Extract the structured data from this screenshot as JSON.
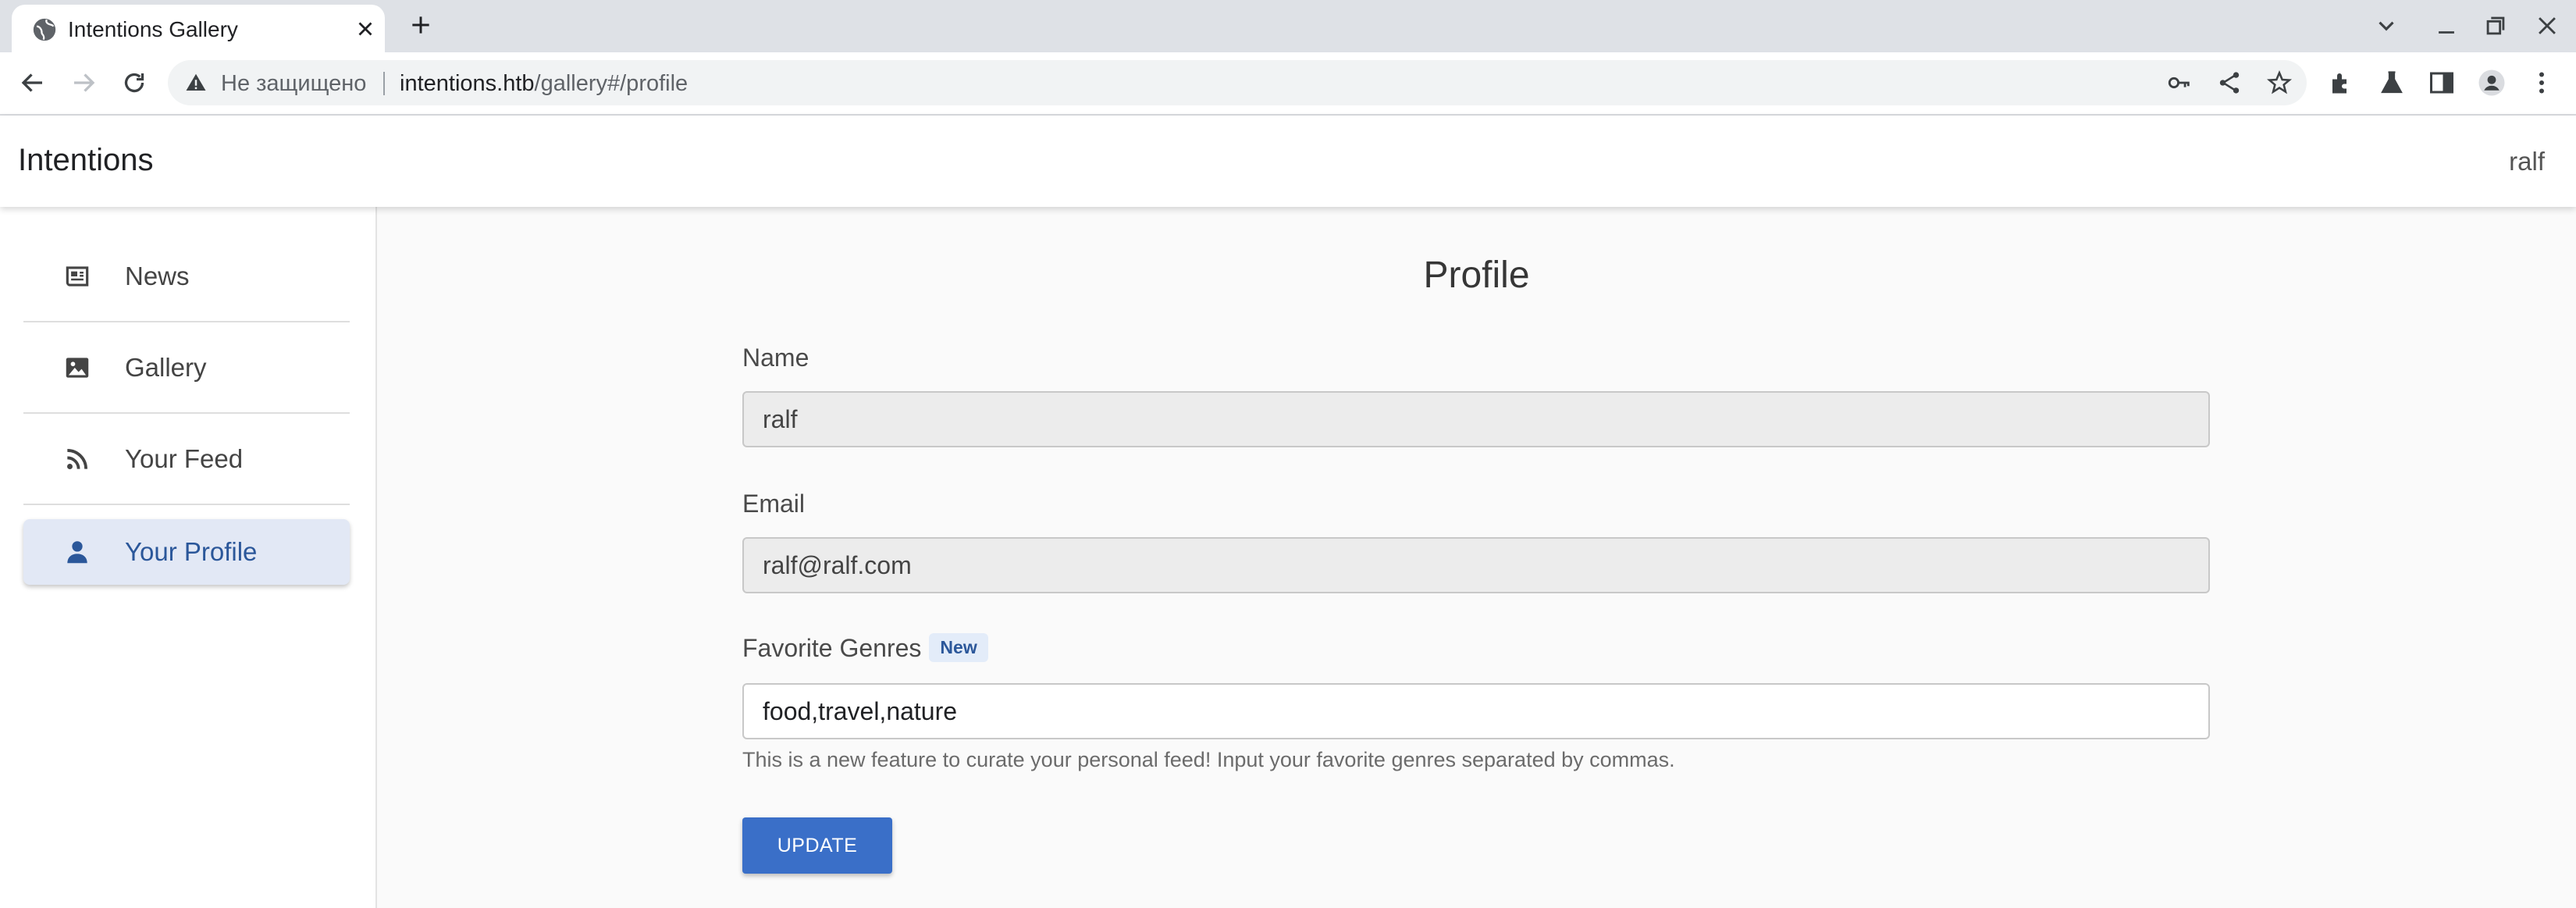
{
  "browser": {
    "tab_title": "Intentions Gallery",
    "security_label": "Не защищено",
    "url_host": "intentions.htb",
    "url_path": "/gallery#/profile"
  },
  "app": {
    "brand": "Intentions",
    "username": "ralf"
  },
  "sidebar": {
    "items": [
      {
        "label": "News",
        "icon": "newspaper-icon",
        "active": false
      },
      {
        "label": "Gallery",
        "icon": "image-icon",
        "active": false
      },
      {
        "label": "Your Feed",
        "icon": "rss-icon",
        "active": false
      },
      {
        "label": "Your Profile",
        "icon": "user-icon",
        "active": true
      }
    ]
  },
  "profile": {
    "title": "Profile",
    "name_label": "Name",
    "name_value": "ralf",
    "email_label": "Email",
    "email_value": "ralf@ralf.com",
    "genres_label": "Favorite Genres",
    "genres_badge": "New",
    "genres_value": "food,travel,nature",
    "genres_help": "This is a new feature to curate your personal feed! Input your favorite genres separated by commas.",
    "update_label": "UPDATE"
  },
  "colors": {
    "accent": "#3a6fc8",
    "active_nav_bg": "#e2e8f5",
    "active_nav_text": "#2b579a"
  }
}
